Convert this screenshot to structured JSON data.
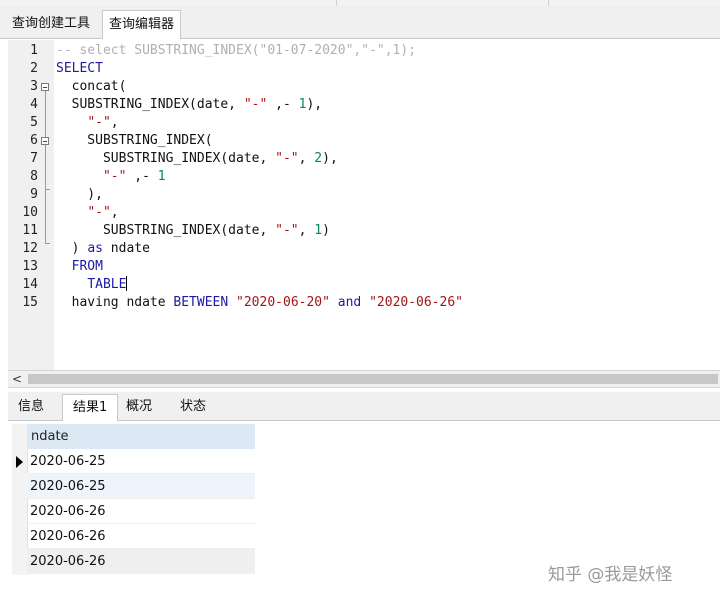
{
  "tabs": [
    "查询创建工具",
    "查询编辑器"
  ],
  "active_tab": 1,
  "editor": {
    "lines": [
      [
        {
          "t": "-- select SUBSTRING_INDEX(\"01-07-2020\",\"-\",1);",
          "c": "comment"
        }
      ],
      [
        {
          "t": "SELECT",
          "c": "kw"
        }
      ],
      [
        {
          "t": "  concat(",
          "c": ""
        }
      ],
      [
        {
          "t": "  SUBSTRING_INDEX(date, ",
          "c": ""
        },
        {
          "t": "\"-\"",
          "c": "str"
        },
        {
          "t": " ,- ",
          "c": ""
        },
        {
          "t": "1",
          "c": "num"
        },
        {
          "t": "),",
          "c": ""
        }
      ],
      [
        {
          "t": "    ",
          "c": ""
        },
        {
          "t": "\"-\"",
          "c": "str"
        },
        {
          "t": ",",
          "c": ""
        }
      ],
      [
        {
          "t": "    SUBSTRING_INDEX(",
          "c": ""
        }
      ],
      [
        {
          "t": "      SUBSTRING_INDEX(date, ",
          "c": ""
        },
        {
          "t": "\"-\"",
          "c": "str"
        },
        {
          "t": ", ",
          "c": ""
        },
        {
          "t": "2",
          "c": "num"
        },
        {
          "t": "),",
          "c": ""
        }
      ],
      [
        {
          "t": "      ",
          "c": ""
        },
        {
          "t": "\"-\"",
          "c": "str"
        },
        {
          "t": " ,- ",
          "c": ""
        },
        {
          "t": "1",
          "c": "num"
        }
      ],
      [
        {
          "t": "    ),",
          "c": ""
        }
      ],
      [
        {
          "t": "    ",
          "c": ""
        },
        {
          "t": "\"-\"",
          "c": "str"
        },
        {
          "t": ",",
          "c": ""
        }
      ],
      [
        {
          "t": "      SUBSTRING_INDEX(date, ",
          "c": ""
        },
        {
          "t": "\"-\"",
          "c": "str"
        },
        {
          "t": ", ",
          "c": ""
        },
        {
          "t": "1",
          "c": "num"
        },
        {
          "t": ")",
          "c": ""
        }
      ],
      [
        {
          "t": "  ) ",
          "c": ""
        },
        {
          "t": "as",
          "c": "kw"
        },
        {
          "t": " ndate",
          "c": ""
        }
      ],
      [
        {
          "t": "  ",
          "c": ""
        },
        {
          "t": "FROM",
          "c": "kw"
        }
      ],
      [
        {
          "t": "    ",
          "c": ""
        },
        {
          "t": "TABLE",
          "c": "kw"
        }
      ],
      [
        {
          "t": "  having ndate ",
          "c": ""
        },
        {
          "t": "BETWEEN",
          "c": "kw"
        },
        {
          "t": " ",
          "c": ""
        },
        {
          "t": "\"2020-06-20\"",
          "c": "str"
        },
        {
          "t": " ",
          "c": ""
        },
        {
          "t": "and",
          "c": "kw"
        },
        {
          "t": " ",
          "c": ""
        },
        {
          "t": "\"2020-06-26\"",
          "c": "str"
        }
      ]
    ],
    "line_numbers": [
      "1",
      "2",
      "3",
      "4",
      "5",
      "6",
      "7",
      "8",
      "9",
      "10",
      "11",
      "12",
      "13",
      "14",
      "15"
    ]
  },
  "scroll_left_glyph": "<",
  "result_tabs": [
    "信息",
    "结果1",
    "概况",
    "状态"
  ],
  "active_result_tab": 1,
  "grid": {
    "column": "ndate",
    "rows": [
      "2020-06-25",
      "2020-06-25",
      "2020-06-26",
      "2020-06-26",
      "2020-06-26"
    ]
  },
  "watermark": "知乎 @我是妖怪",
  "colors": {
    "keyword": "#1a1aa6",
    "string": "#a31515",
    "number": "#098658",
    "comment": "#b0b0b0",
    "header": "#dce9f5"
  }
}
